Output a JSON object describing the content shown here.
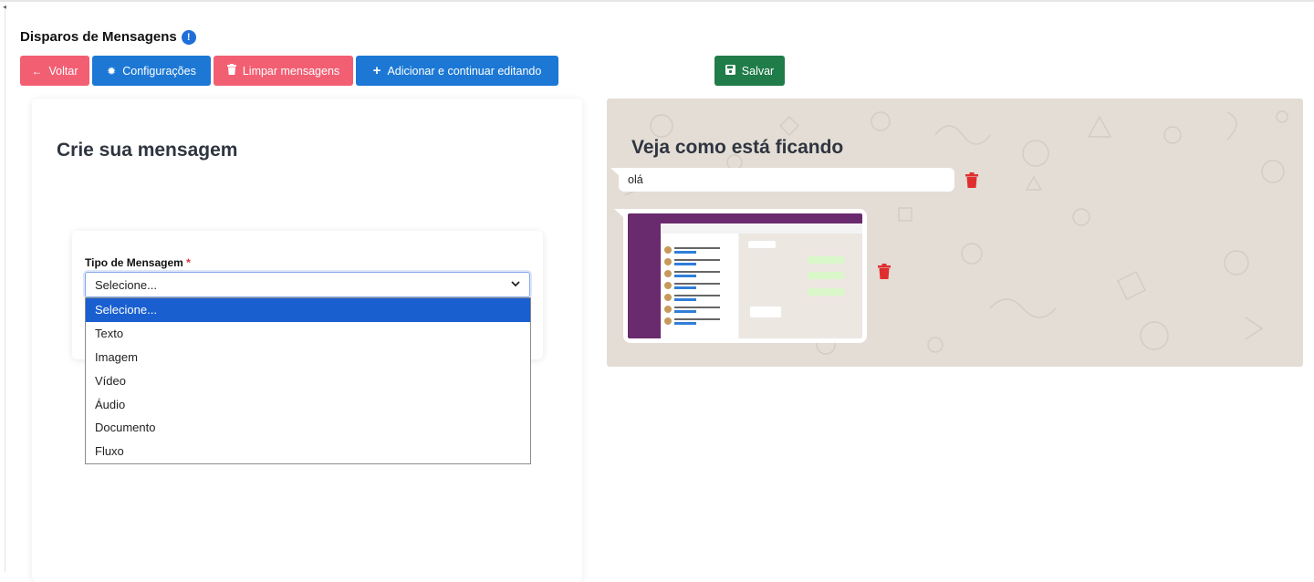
{
  "page": {
    "title": "Disparos de Mensagens"
  },
  "toolbar": {
    "back_label": "Voltar",
    "config_label": "Configurações",
    "clear_label": "Limpar mensagens",
    "add_label": "Adicionar e continuar editando",
    "save_label": "Salvar"
  },
  "colors": {
    "red": "#f25f73",
    "blue": "#1c78d4",
    "green": "#207c48",
    "selected": "#1a5fd0"
  },
  "editor": {
    "heading": "Crie sua mensagem",
    "field_label": "Tipo de Mensagem",
    "required_mark": "*",
    "selected_value": "Selecione...",
    "options": [
      "Selecione...",
      "Texto",
      "Imagem",
      "Vídeo",
      "Áudio",
      "Documento",
      "Fluxo"
    ]
  },
  "preview": {
    "heading": "Veja como está ficando",
    "text_message": "olá"
  },
  "icons": {
    "back": "arrow-left-icon",
    "config": "gear-icon",
    "clear": "trash-icon",
    "add": "plus-icon",
    "save": "floppy-disk-icon",
    "info": "info-icon"
  }
}
